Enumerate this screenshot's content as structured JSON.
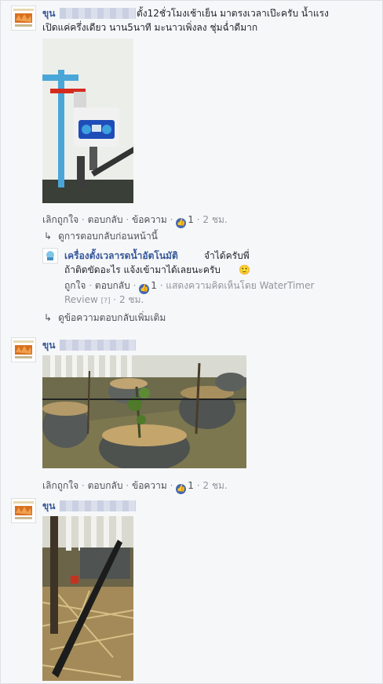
{
  "comment1": {
    "name": "ขุน",
    "text_line1": "ตั้ง12ชั่วโมงเช้าเย็น มาตรงเวลาเป๊ะครับ น้ำแรง",
    "text_line2": "เปิดแค่ครึ่งเดียว นาน5นาที มะนาวเพิ่งลง ชุ่มฉ่ำดีมาก",
    "actions": {
      "unlike": "เลิกถูกใจ",
      "reply": "ตอบกลับ",
      "message": "ข้อความ",
      "likes": "1",
      "time": "2 ชม."
    }
  },
  "view_previous": "ดูการตอบกลับก่อนหน้านี้",
  "reply": {
    "name": "เครื่องตั้งเวลารดน้ำอัตโนมัติ",
    "name_suffix": "จำได้ครับพี่",
    "text": "ถ้าติดขัดอะไร แจ้งเข้ามาได้เลยนะครับ",
    "emoji": "🙂",
    "actions": {
      "like": "ถูกใจ",
      "reply": "ตอบกลับ",
      "likes": "1",
      "seen_by": "แสดงความคิดเห็นโดย WaterTimer",
      "review": "Review",
      "review_badge": "[?]",
      "time": "2 ชม."
    }
  },
  "more_replies": "ดูข้อความตอบกลับเพิ่มเติม",
  "comment2": {
    "name": "ขุน",
    "actions": {
      "unlike": "เลิกถูกใจ",
      "reply": "ตอบกลับ",
      "message": "ข้อความ",
      "likes": "1",
      "time": "2 ชม."
    }
  },
  "comment3": {
    "name": "ขุน"
  },
  "separator": "·",
  "colors": {
    "link": "#365899",
    "meta": "#90949c",
    "like_blue": "#4267b2",
    "background": "#f6f7f9"
  },
  "icons": [
    "reply-arrow-icon",
    "like-thumb-icon",
    "smile-emoji"
  ]
}
